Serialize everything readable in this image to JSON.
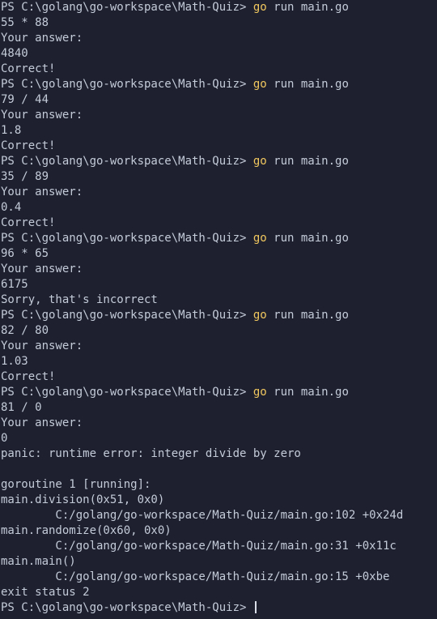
{
  "terminal": {
    "prompt": "PS C:\\golang\\go-workspace\\Math-Quiz> ",
    "command_keyword": "go",
    "command_rest": " run main.go",
    "accent_color": "#f0c75e",
    "background": "#1e2030",
    "foreground": "#c4cbd8",
    "lines": [
      {
        "type": "command"
      },
      {
        "type": "text",
        "text": "55 * 88"
      },
      {
        "type": "text",
        "text": "Your answer:"
      },
      {
        "type": "text",
        "text": "4840"
      },
      {
        "type": "text",
        "text": "Correct!"
      },
      {
        "type": "command"
      },
      {
        "type": "text",
        "text": "79 / 44"
      },
      {
        "type": "text",
        "text": "Your answer:"
      },
      {
        "type": "text",
        "text": "1.8"
      },
      {
        "type": "text",
        "text": "Correct!"
      },
      {
        "type": "command"
      },
      {
        "type": "text",
        "text": "35 / 89"
      },
      {
        "type": "text",
        "text": "Your answer:"
      },
      {
        "type": "text",
        "text": "0.4"
      },
      {
        "type": "text",
        "text": "Correct!"
      },
      {
        "type": "command"
      },
      {
        "type": "text",
        "text": "96 * 65"
      },
      {
        "type": "text",
        "text": "Your answer:"
      },
      {
        "type": "text",
        "text": "6175"
      },
      {
        "type": "text",
        "text": "Sorry, that's incorrect"
      },
      {
        "type": "command"
      },
      {
        "type": "text",
        "text": "82 / 80"
      },
      {
        "type": "text",
        "text": "Your answer:"
      },
      {
        "type": "text",
        "text": "1.03"
      },
      {
        "type": "text",
        "text": "Correct!"
      },
      {
        "type": "command"
      },
      {
        "type": "text",
        "text": "81 / 0"
      },
      {
        "type": "text",
        "text": "Your answer:"
      },
      {
        "type": "text",
        "text": "0"
      },
      {
        "type": "text",
        "text": "panic: runtime error: integer divide by zero"
      },
      {
        "type": "text",
        "text": ""
      },
      {
        "type": "text",
        "text": "goroutine 1 [running]:"
      },
      {
        "type": "text",
        "text": "main.division(0x51, 0x0)"
      },
      {
        "type": "text",
        "text": "        C:/golang/go-workspace/Math-Quiz/main.go:102 +0x24d"
      },
      {
        "type": "text",
        "text": "main.randomize(0x60, 0x0)"
      },
      {
        "type": "text",
        "text": "        C:/golang/go-workspace/Math-Quiz/main.go:31 +0x11c"
      },
      {
        "type": "text",
        "text": "main.main()"
      },
      {
        "type": "text",
        "text": "        C:/golang/go-workspace/Math-Quiz/main.go:15 +0xbe"
      },
      {
        "type": "text",
        "text": "exit status 2"
      },
      {
        "type": "prompt"
      }
    ]
  }
}
